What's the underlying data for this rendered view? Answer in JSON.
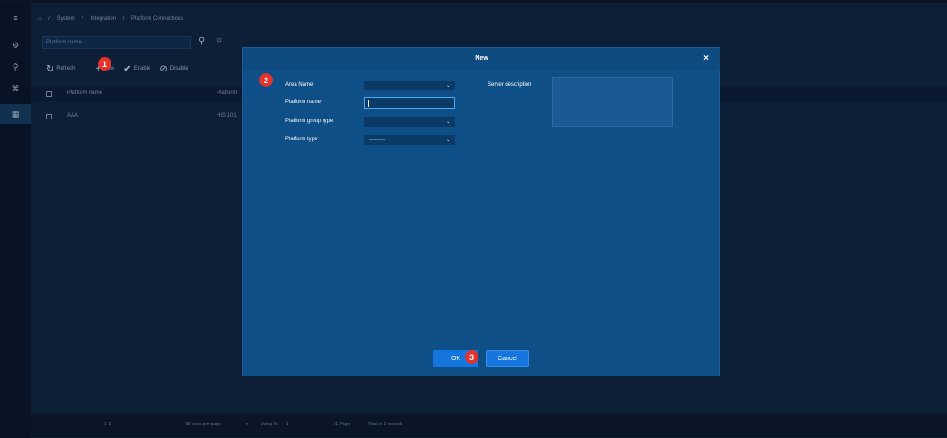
{
  "breadcrumb": {
    "home_icon": "home-icon",
    "sep1": "/",
    "item1": "System",
    "sep2": "/",
    "item2": "Integration",
    "sep3": "/",
    "item3": "Platform Connections"
  },
  "search": {
    "placeholder": "Platform name"
  },
  "toolbar": {
    "refresh_label": "Refresh",
    "new_label": "New",
    "enable_label": "Enable",
    "disable_label": "Disable"
  },
  "table": {
    "columns": [
      "Platform name",
      "Platform"
    ],
    "rows": [
      {
        "name": "AAA",
        "platform": "HIS 101"
      }
    ]
  },
  "footer": {
    "range": "1-1",
    "rows_per_page": "50 rows per page",
    "jump_label": "Jump To",
    "jump_value": "1",
    "pages": "/1 Page",
    "total": "Total of 1 records"
  },
  "modal": {
    "title": "New",
    "close": "×",
    "area_label": "Area Name",
    "platform_name_label": "Platform name",
    "group_type_label": "Platform group type",
    "platform_type_label": "Platform type",
    "platform_type_value": "———",
    "server_desc_label": "Server description",
    "required_mark": "*",
    "ok_label": "OK",
    "cancel_label": "Cancel"
  },
  "annotations": {
    "step1": "1",
    "step2": "2",
    "step3": "3"
  },
  "colors": {
    "modal_bg": "#0f4f87",
    "primary_button": "#1676e0",
    "badge": "#e5322d",
    "page_bg": "#0d1f36"
  }
}
